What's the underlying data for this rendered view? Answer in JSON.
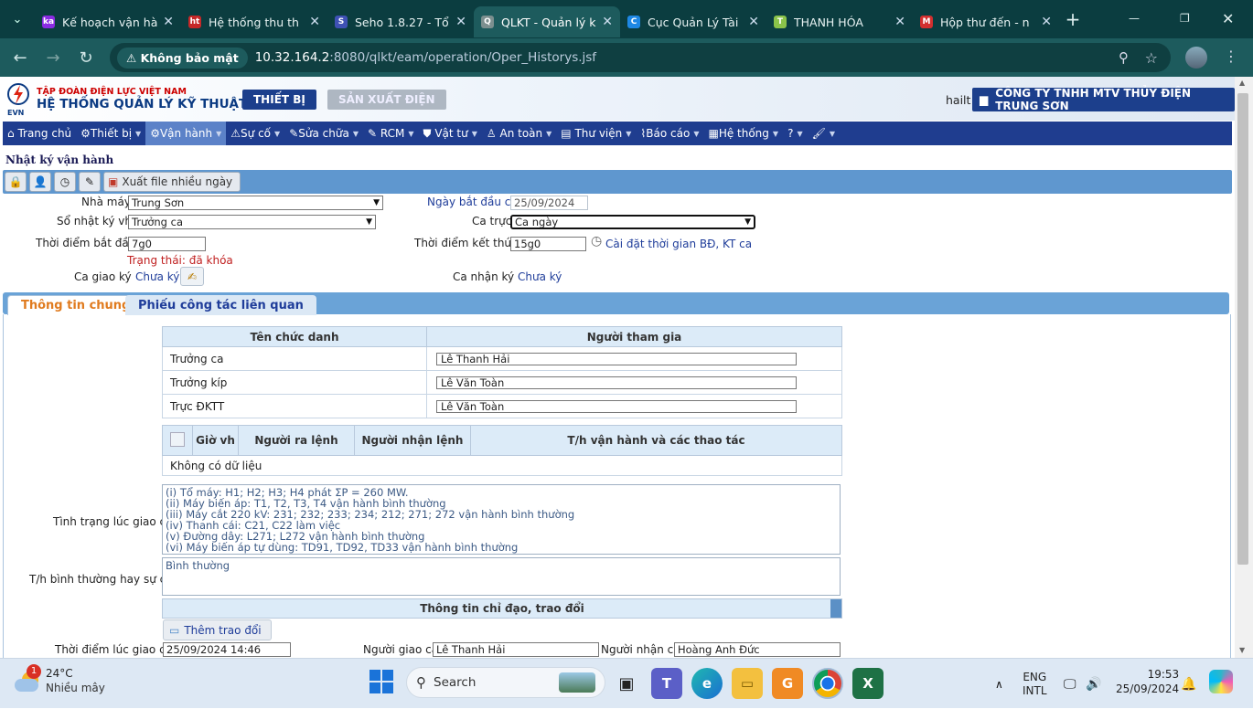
{
  "browser": {
    "tabs": [
      {
        "title": "Kế hoạch vận hà",
        "fav": "ka",
        "color": "#8a2be2"
      },
      {
        "title": "Hệ thống thu th",
        "fav": "ht",
        "color": "#c62828"
      },
      {
        "title": "Seho 1.8.27 - Tổ",
        "fav": "S",
        "color": "#3f51b5"
      },
      {
        "title": "QLKT - Quản lý k",
        "fav": "Q",
        "color": "#7c8f8f",
        "active": true
      },
      {
        "title": "Cục Quản Lý Tài",
        "fav": "C",
        "color": "#1e88e5"
      },
      {
        "title": "THANH HÓA",
        "fav": "T",
        "color": "#8bc34a"
      },
      {
        "title": "Hộp thư đến - n",
        "fav": "M",
        "color": "#d32f2f"
      }
    ],
    "security_label": "Không bảo mật",
    "url_host": "10.32.164.2",
    "url_rest": ":8080/qlkt/eam/operation/Oper_Historys.jsf"
  },
  "header": {
    "corp_line1": "TẬP ĐOÀN ĐIỆN LỰC VIỆT NAM",
    "corp_line2": "HỆ THỐNG QUẢN LÝ KỸ THUẬT",
    "logo_text": "EVN",
    "module_device": "THIẾT BỊ",
    "module_production": "SẢN XUẤT ĐIỆN",
    "username": "hailt",
    "company": "CÔNG TY TNHH MTV THỦY ĐIỆN TRUNG SƠN"
  },
  "nav": {
    "home": "Trang chủ",
    "device": "Thiết bị",
    "operation": "Vận hành",
    "incident": "Sự cố",
    "repair": "Sửa chữa",
    "rcm": "RCM",
    "material": "Vật tư",
    "safety": "An toàn",
    "library": "Thư viện",
    "report": "Báo cáo",
    "system": "Hệ thống",
    "help": "?"
  },
  "page": {
    "title": "Nhật ký vận hành",
    "export_label": "Xuất file nhiều ngày"
  },
  "form": {
    "plant_label": "Nhà máy",
    "plant_value": "Trung Sơn",
    "log_label": "Sổ nhật ký vh",
    "log_value": "Trưởng ca",
    "start_label": "Thời điểm bắt đầu",
    "start_value": "7g0",
    "start_date_label": "Ngày bắt đầu ca",
    "start_date_value": "25/09/2024",
    "shift_label": "Ca trực",
    "shift_value": "Ca ngày",
    "end_label": "Thời điểm kết thúc",
    "end_value": "15g0",
    "time_setting_link": "Cài đặt thời gian BĐ, KT ca",
    "status_text": "Trạng thái: đã khóa",
    "hand_sign_label": "Ca giao ký",
    "hand_sign_value": "Chưa ký",
    "recv_sign_label": "Ca nhận ký",
    "recv_sign_value": "Chưa ký"
  },
  "tabs": {
    "general": "Thông tin chung",
    "related": "Phiếu công tác liên quan"
  },
  "participants": {
    "col_title": "Tên chức danh",
    "col_person": "Người tham gia",
    "rows": [
      {
        "title": "Trưởng ca",
        "person": "Lê Thanh Hải"
      },
      {
        "title": "Trưởng kíp",
        "person": "Lê Văn Toàn"
      },
      {
        "title": "Trực ĐKTT",
        "person": "Lê Văn Toàn"
      }
    ]
  },
  "orders": {
    "col_hour": "Giờ vh",
    "col_giver": "Người ra lệnh",
    "col_receiver": "Người nhận lệnh",
    "col_action": "T/h vận hành và các thao tác",
    "empty": "Không có dữ liệu"
  },
  "handover": {
    "status_label": "Tình trạng lúc giao ca",
    "status_text": "(i) Tổ máy: H1; H2; H3; H4 phát ΣP = 260 MW.\n(ii) Máy biến áp: T1, T2, T3, T4 vận hành bình thường\n(iii) Máy cắt 220 kV: 231; 232; 233; 234; 212; 271; 272 vận hành bình thường\n(iv) Thanh cái: C21, C22 làm việc\n(v) Đường dây: L271; L272 vận hành bình thường\n(vi) Máy biến áp tự dùng: TD91, TD92, TD33 vận hành bình thường",
    "incident_label": "T/h bình thường hay sự cố",
    "incident_text": "Bình thường",
    "section_title": "Thông tin chỉ đạo, trao đổi",
    "add_button": "Thêm trao đổi",
    "time_label": "Thời điểm lúc giao ca",
    "time_value": "25/09/2024 14:46",
    "giver_label": "Người giao ca",
    "giver_value": "Lê Thanh Hải",
    "receiver_label": "Người nhận ca",
    "receiver_value": "Hoàng Anh Đức"
  },
  "taskbar": {
    "weather_temp": "24°C",
    "weather_desc": "Nhiều mây",
    "weather_badge": "1",
    "search_placeholder": "Search",
    "lang1": "ENG",
    "lang2": "INTL",
    "time": "19:53",
    "date": "25/09/2024"
  }
}
